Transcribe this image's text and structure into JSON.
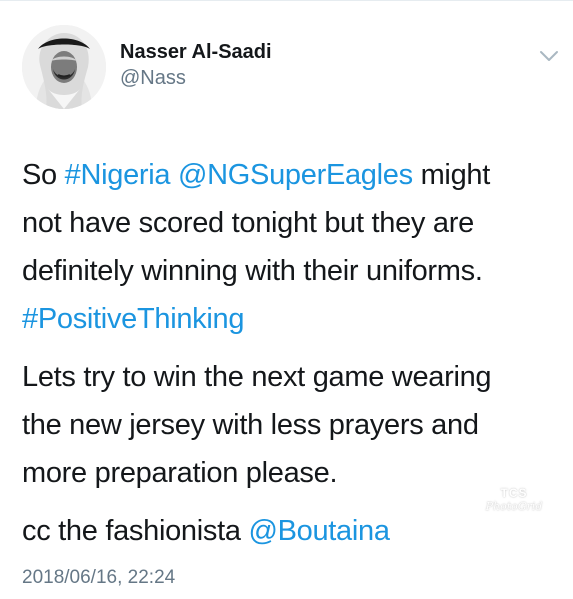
{
  "user": {
    "name": "Nasser Al-Saadi",
    "handle": "@Nass"
  },
  "tweet": {
    "p1": {
      "t0": "So ",
      "hashtag1": "#Nigeria",
      "t1": " ",
      "mention1": "@NGSuperEagles",
      "t2": " might",
      "line2": "not have scored tonight but they are",
      "line3": "definitely winning with their uniforms.",
      "hashtag2": "#PositiveThinking"
    },
    "p2": {
      "line1": "Lets try to win the next game wearing",
      "line2": "the new jersey with less prayers and",
      "line3": "more preparation please."
    },
    "p3": {
      "t0": "cc the fashionista ",
      "mention": "@Boutaina"
    },
    "timestamp": "2018/06/16, 22:24"
  },
  "watermark": {
    "top": "TCS",
    "bottom": "PhotoGrid"
  },
  "icons": {
    "avatar": "profile-photo",
    "menu": "chevron-down-icon"
  },
  "colors": {
    "link": "#1b95e0",
    "text": "#14171a",
    "secondary": "#657786"
  }
}
